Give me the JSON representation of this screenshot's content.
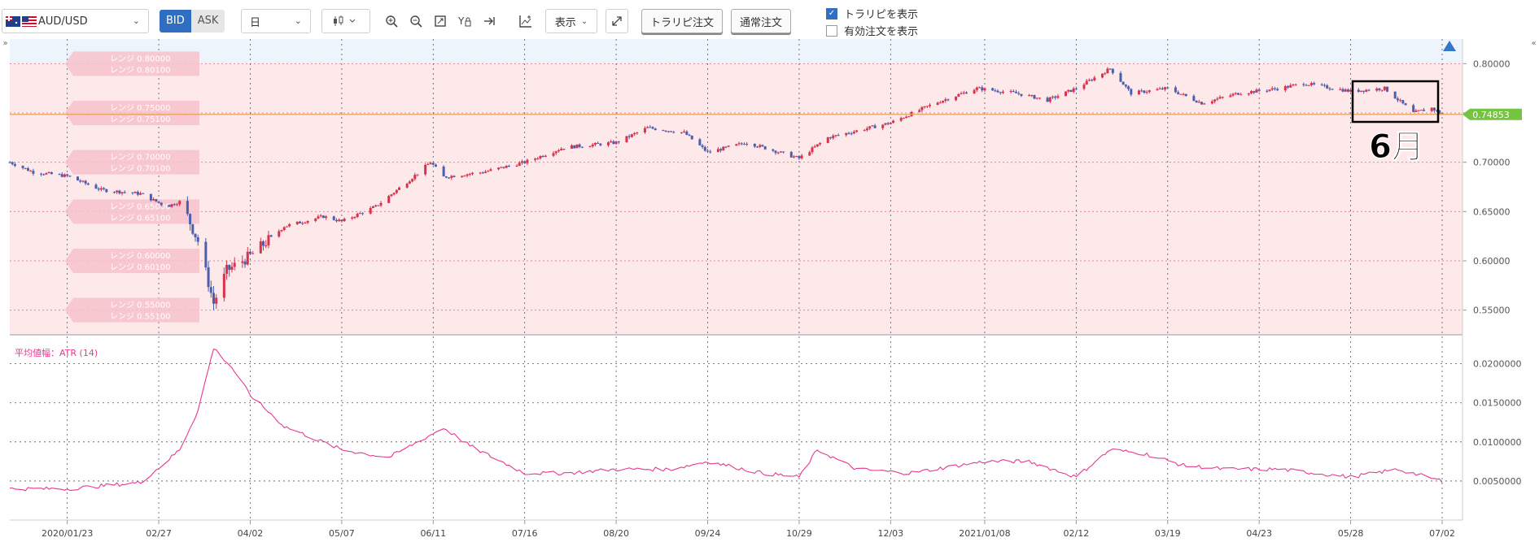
{
  "toolbar": {
    "symbol": "AUD/USD",
    "bid_label": "BID",
    "ask_label": "ASK",
    "period": "日",
    "display_label": "表示",
    "tralipi_order_label": "トラリピ注文",
    "normal_order_label": "通常注文",
    "show_tralipi_label": "トラリピを表示",
    "show_tralipi_checked": true,
    "show_valid_orders_label": "有効注文を表示",
    "show_valid_orders_checked": false
  },
  "colors": {
    "accent": "#2f6ec0",
    "up_candle": "#d8324d",
    "down_candle": "#4a5fae",
    "range_band": "#fde8ea",
    "atr_line": "#e6388f",
    "current_price_tag": "#74c442"
  },
  "annotation": {
    "label": "6月"
  },
  "chart_data": [
    {
      "type": "candlestick",
      "series": [
        {
          "name": "AUD/USD"
        }
      ],
      "current_price": 0.74853,
      "ylim": [
        0.525,
        0.825
      ],
      "y_ticks": [
        0.8,
        0.75,
        0.7,
        0.65,
        0.6,
        0.55
      ],
      "y_tick_labels": [
        "0.80000",
        "0.75000",
        "0.70000",
        "0.65000",
        "0.60000",
        "0.55000"
      ],
      "x_tick_labels": [
        "2020/01/23",
        "02/27",
        "04/02",
        "05/07",
        "06/11",
        "07/16",
        "08/20",
        "09/24",
        "10/29",
        "12/03",
        "2021/01/08",
        "02/12",
        "03/19",
        "04/23",
        "05/28",
        "07/02"
      ],
      "x_date_range": [
        "2020/01/01",
        "2021/07/02"
      ],
      "grid": true,
      "range_labels": [
        {
          "top": "レンジ 0.80000",
          "bottom": "レンジ 0.80100"
        },
        {
          "top": "レンジ 0.75000",
          "bottom": "レンジ 0.75100"
        },
        {
          "top": "レンジ 0.70000",
          "bottom": "レンジ 0.70100"
        },
        {
          "top": "レンジ 0.65000",
          "bottom": "レンジ 0.65100"
        },
        {
          "top": "レンジ 0.60000",
          "bottom": "レンジ 0.60100"
        },
        {
          "top": "レンジ 0.55000",
          "bottom": "レンジ 0.55100"
        }
      ],
      "close_path": [
        [
          "2020/01/01",
          0.7
        ],
        [
          "2020/01/10",
          0.69
        ],
        [
          "2020/01/23",
          0.686
        ],
        [
          "2020/02/05",
          0.672
        ],
        [
          "2020/02/20",
          0.668
        ],
        [
          "2020/03/01",
          0.655
        ],
        [
          "2020/03/06",
          0.66
        ],
        [
          "2020/03/09",
          0.645
        ],
        [
          "2020/03/13",
          0.62
        ],
        [
          "2020/03/19",
          0.557
        ],
        [
          "2020/03/24",
          0.59
        ],
        [
          "2020/04/02",
          0.605
        ],
        [
          "2020/04/15",
          0.635
        ],
        [
          "2020/04/30",
          0.645
        ],
        [
          "2020/05/07",
          0.64
        ],
        [
          "2020/05/20",
          0.655
        ],
        [
          "2020/06/01",
          0.68
        ],
        [
          "2020/06/10",
          0.7
        ],
        [
          "2020/06/15",
          0.685
        ],
        [
          "2020/06/30",
          0.69
        ],
        [
          "2020/07/16",
          0.7
        ],
        [
          "2020/07/31",
          0.715
        ],
        [
          "2020/08/20",
          0.72
        ],
        [
          "2020/09/01",
          0.735
        ],
        [
          "2020/09/15",
          0.73
        ],
        [
          "2020/09/24",
          0.71
        ],
        [
          "2020/10/09",
          0.72
        ],
        [
          "2020/10/29",
          0.704
        ],
        [
          "2020/11/09",
          0.725
        ],
        [
          "2020/12/03",
          0.74
        ],
        [
          "2020/12/20",
          0.76
        ],
        [
          "2021/01/05",
          0.775
        ],
        [
          "2021/01/20",
          0.77
        ],
        [
          "2021/02/01",
          0.763
        ],
        [
          "2021/02/12",
          0.775
        ],
        [
          "2021/02/25",
          0.795
        ],
        [
          "2021/03/05",
          0.77
        ],
        [
          "2021/03/19",
          0.775
        ],
        [
          "2021/04/01",
          0.76
        ],
        [
          "2021/04/15",
          0.77
        ],
        [
          "2021/05/01",
          0.775
        ],
        [
          "2021/05/10",
          0.78
        ],
        [
          "2021/05/28",
          0.772
        ],
        [
          "2021/06/10",
          0.775
        ],
        [
          "2021/06/21",
          0.75
        ],
        [
          "2021/06/28",
          0.755
        ],
        [
          "2021/07/02",
          0.7485
        ]
      ]
    },
    {
      "type": "line",
      "title": "平均値幅：ATR (14)",
      "series": [
        {
          "name": "ATR (14)"
        }
      ],
      "ylim": [
        0.0,
        0.0235
      ],
      "y_ticks": [
        0.02,
        0.015,
        0.01,
        0.005
      ],
      "y_tick_labels": [
        "0.0200000",
        "0.0150000",
        "0.0100000",
        "0.0050000"
      ],
      "grid": true,
      "points": [
        [
          "2020/01/01",
          0.004
        ],
        [
          "2020/01/23",
          0.004
        ],
        [
          "2020/02/20",
          0.0048
        ],
        [
          "2020/03/01",
          0.0075
        ],
        [
          "2020/03/06",
          0.009
        ],
        [
          "2020/03/13",
          0.014
        ],
        [
          "2020/03/19",
          0.022
        ],
        [
          "2020/03/26",
          0.0195
        ],
        [
          "2020/04/02",
          0.016
        ],
        [
          "2020/04/15",
          0.012
        ],
        [
          "2020/05/07",
          0.009
        ],
        [
          "2020/05/25",
          0.008
        ],
        [
          "2020/06/05",
          0.01
        ],
        [
          "2020/06/15",
          0.0118
        ],
        [
          "2020/06/25",
          0.0095
        ],
        [
          "2020/07/16",
          0.006
        ],
        [
          "2020/08/01",
          0.006
        ],
        [
          "2020/08/20",
          0.0065
        ],
        [
          "2020/09/10",
          0.0065
        ],
        [
          "2020/09/24",
          0.0075
        ],
        [
          "2020/10/15",
          0.006
        ],
        [
          "2020/10/29",
          0.0055
        ],
        [
          "2020/11/05",
          0.009
        ],
        [
          "2020/11/20",
          0.0065
        ],
        [
          "2020/12/10",
          0.006
        ],
        [
          "2021/01/08",
          0.0075
        ],
        [
          "2021/01/25",
          0.0075
        ],
        [
          "2021/02/12",
          0.0055
        ],
        [
          "2021/02/25",
          0.009
        ],
        [
          "2021/03/10",
          0.0085
        ],
        [
          "2021/03/25",
          0.007
        ],
        [
          "2021/04/10",
          0.0065
        ],
        [
          "2021/05/01",
          0.0065
        ],
        [
          "2021/05/28",
          0.0055
        ],
        [
          "2021/06/15",
          0.0065
        ],
        [
          "2021/07/02",
          0.005
        ]
      ]
    }
  ]
}
